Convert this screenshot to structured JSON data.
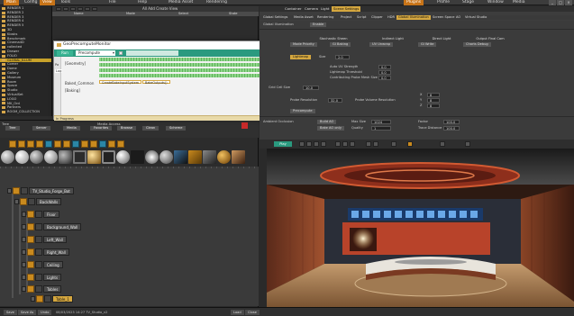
{
  "top_menu": {
    "items": [
      "Main",
      "Config",
      "View",
      "Tools",
      "File",
      "Help",
      "Media Asset",
      "Rendering",
      "Plugins",
      "Profile",
      "Stage",
      "Window",
      "Media"
    ],
    "window_controls": [
      "_",
      "□",
      "×"
    ]
  },
  "scene_tree": {
    "items": [
      "RENDER 1",
      "RENDER 2",
      "RENDER 3",
      "RENDER 4",
      "RENDER 5",
      "3D",
      "Kiosks",
      "Benchmark",
      "Cinema4D",
      "collected",
      "Drawer",
      "FOLIO",
      "GLOBAL_ILLUM",
      "Corner",
      "Dome",
      "Gallery",
      "Museum",
      "Room",
      "Space",
      "Studio",
      "VirtualSet",
      "LOGO",
      "MK_Ord",
      "Partners",
      "ROOM_COLLECTION"
    ]
  },
  "top_strip": {
    "add_view_label": "All  Add Create View",
    "columns": [
      "Name",
      "Mode",
      "Select",
      "State"
    ]
  },
  "dialog": {
    "title": "GeoPrecomputeMonitor",
    "controls": [
      "—",
      "☐",
      "✕"
    ],
    "run_button": "Run",
    "mode_combo": "Precompute",
    "side_labels": [
      "Pa",
      "Log"
    ],
    "stages": [
      "[Geometry]",
      "Baked_Common",
      "[Baking]"
    ],
    "baked_chips": [
      "CreateBakeInputSystem",
      "BakeOutputs()"
    ],
    "progress_label": "In Progress"
  },
  "media_toolbar": {
    "tree_label": "Tree",
    "media_access_label": "Media Access",
    "tabs": [
      "Tree",
      "Server",
      "Media",
      "Favorites",
      "Browse",
      "Clean",
      "Scheme"
    ]
  },
  "node_graph": {
    "nodes": [
      "TV_Studio_Forge_Bot",
      "BackWalls",
      "Floor",
      "Background_Wall",
      "Left_Wall",
      "Right_Wall",
      "Ceiling",
      "Lights",
      "Tables",
      "Table_1"
    ]
  },
  "status_bar": {
    "buttons": [
      "Save",
      "Save As",
      "Undo"
    ],
    "path": "08/03/2023 14:27 TV_Studio_v2",
    "right_buttons": [
      "Load",
      "Close"
    ]
  },
  "right_pane": {
    "tabs": [
      "Container",
      "Camera",
      "Light",
      "Scene Settings"
    ],
    "active_tab": "Scene Settings",
    "settings_tabs": [
      "Global Settings",
      "Media Asset",
      "Rendering",
      "Project",
      "Script",
      "Clipper",
      "HDR",
      "Global Illumination",
      "Screen Space",
      "AO",
      "Virtual Studio"
    ],
    "active_settings_tab": "Global Illumination",
    "gi_label": "Global Illumination",
    "gi_toggle": "Enable",
    "columns": [
      "Stochastic Sheen",
      "Indirect Light",
      "Direct Light",
      "Output Final Cam"
    ],
    "subcolumns": [
      "Mode Priority",
      "GI Baking",
      "UV Unwrap",
      "GI Write",
      "Charts Debug"
    ],
    "lightmap_label": "Lightmap",
    "size_label": "Size",
    "size_value": "2.0",
    "auto_uv_label": "Auto UV Strength",
    "lightmap_threshold_label": "Lightmap Threshold",
    "contributing_label": "Contributing Probe Mesh Size",
    "auto_uv_value": "0.0",
    "threshold_value": "0.0",
    "contrib_value": "0.0",
    "cell_size_label": "Grid Cell Size",
    "cell_size_value": "10.0",
    "probe_res_label": "Probe Resolution",
    "probe_res_value": "32.0",
    "probe_vol_label": "Probe Volume Resolution",
    "xyz_labels": [
      "X",
      "Y",
      "Z"
    ],
    "xyz_values": [
      "8",
      "8",
      "8"
    ],
    "precompute_button": "Precompute",
    "ambient_label": "Ambient Occlusion",
    "ao_buttons": [
      "Build AO",
      "Bake AO only"
    ],
    "max_size_label": "Max Size",
    "max_size_value": "1024",
    "quality_label": "Quality",
    "quality_value": "1",
    "factor_label": "Factor",
    "factor_value": "100.0",
    "trace_label": "Trace Distance",
    "trace_value": "100.0"
  },
  "viewport": {
    "play_label": "Play"
  },
  "colors": {
    "accent_orange": "#d5a73f",
    "dialog_teal": "#2a9a7f",
    "progress_green": "#8fd48a",
    "studio_red": "#b8432a",
    "studio_floor": "#c39a6d"
  }
}
